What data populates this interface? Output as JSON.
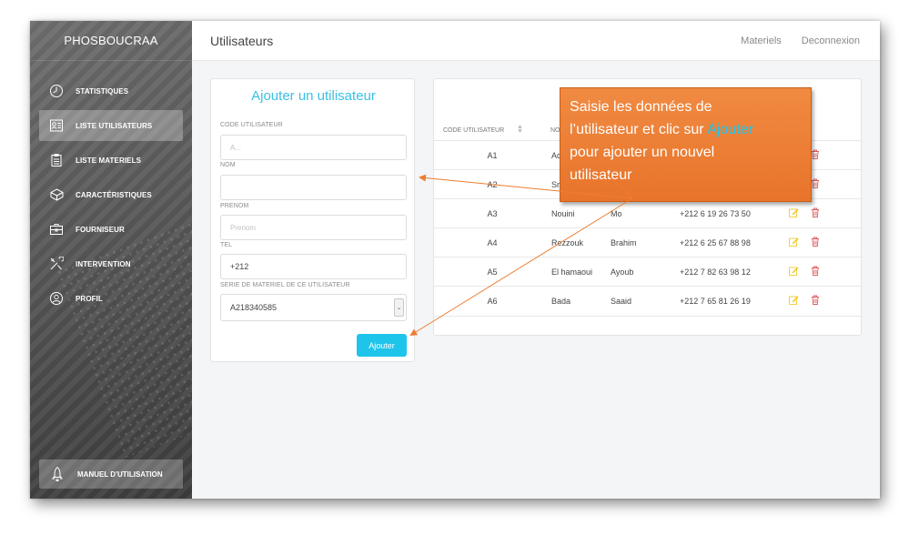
{
  "app": {
    "brand": "PHOSBOUCRAA"
  },
  "topbar": {
    "title": "Utilisateurs",
    "links": [
      "Materiels",
      "Deconnexion"
    ]
  },
  "sidebar": {
    "items": [
      {
        "label": "STATISTIQUES",
        "icon": "clock-icon",
        "active": false
      },
      {
        "label": "LISTE UTILISATEURS",
        "icon": "user-list-icon",
        "active": true
      },
      {
        "label": "LISTE MATERIELS",
        "icon": "clipboard-icon",
        "active": false
      },
      {
        "label": "CARACTÉRISTIQUES",
        "icon": "cube-icon",
        "active": false
      },
      {
        "label": "FOURNISEUR",
        "icon": "briefcase-icon",
        "active": false
      },
      {
        "label": "INTERVENTION",
        "icon": "tools-icon",
        "active": false
      },
      {
        "label": "PROFIL",
        "icon": "profile-icon",
        "active": false
      }
    ],
    "manual": {
      "label": "MANUEL D'UTILISATION",
      "icon": "rocket-icon"
    }
  },
  "form": {
    "title": "Ajouter un utilisateur",
    "code_label": "CODE UTILISATEUR",
    "code_placeholder": "A...",
    "nom_label": "NOM",
    "nom_value": "",
    "prenom_label": "PRENOM",
    "prenom_placeholder": "Prenom",
    "tel_label": "TEL",
    "tel_value": "+212",
    "serie_label": "SERIE DE MATERIEL DE CE UTILISATEUR",
    "serie_value": "A218340585",
    "submit_label": "Ajouter"
  },
  "table": {
    "headers": {
      "code": "CODE UTILISATEUR",
      "nom": "NO"
    },
    "rows": [
      {
        "code": "A1",
        "nom": "Ac",
        "prenom": "",
        "tel": ""
      },
      {
        "code": "A2",
        "nom": "Sr",
        "prenom": "",
        "tel": ""
      },
      {
        "code": "A3",
        "nom": "Nouini",
        "prenom": "Mo",
        "tel": "+212 6 19 26 73 50"
      },
      {
        "code": "A4",
        "nom": "Rezzouk",
        "prenom": "Brahim",
        "tel": "+212 6 25 67 88 98"
      },
      {
        "code": "A5",
        "nom": "El hamaoui",
        "prenom": "Ayoub",
        "tel": "+212 7 82 63 98 12"
      },
      {
        "code": "A6",
        "nom": "Bada",
        "prenom": "Saaid",
        "tel": "+212 7 65 81 26 19"
      }
    ]
  },
  "callout": {
    "line1": "Saisie les données de",
    "line2_pre": "l’utilisateur et clic sur ",
    "line2_hl": "Ajouter",
    "line3": "pour ajouter un nouvel",
    "line4": "utilisateur"
  },
  "colors": {
    "accent": "#1fc4eb",
    "title": "#39c0e3",
    "callout": "#ed7d31",
    "edit": "#f0c419",
    "delete": "#e05a5a"
  }
}
